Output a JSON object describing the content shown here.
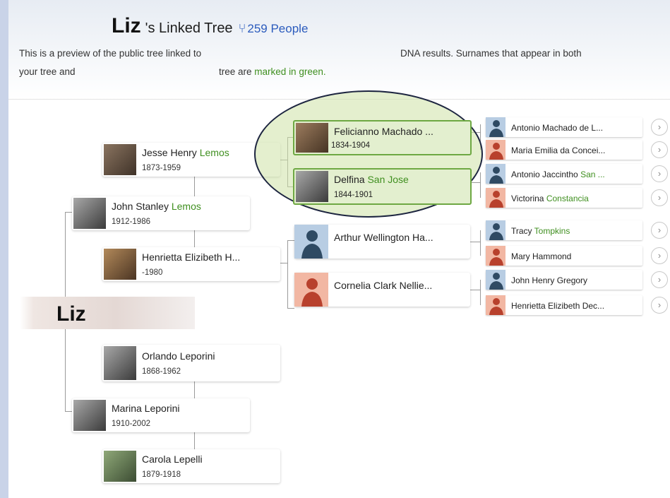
{
  "header": {
    "owner": "Liz",
    "title_suffix": "'s Linked Tree",
    "people_count": "259 People",
    "desc_line1_a": "This is a preview of the public tree linked to",
    "desc_line1_b": "DNA results. Surnames that appear in both",
    "desc_line2_a": "your tree and",
    "desc_line2_b": "tree are",
    "desc_line2_link": "marked in green."
  },
  "root": {
    "name": "Liz"
  },
  "people": {
    "jesse": {
      "first": "Jesse Henry ",
      "surname": "Lemos",
      "dates": "1873-1959"
    },
    "john_stanley": {
      "first": "John Stanley ",
      "surname": "Lemos",
      "dates": "1912-1986"
    },
    "henrietta_h": {
      "name": "Henrietta Elizibeth H...",
      "dates": "-1980"
    },
    "orlando": {
      "name": "Orlando Leporini",
      "dates": "1868-1962"
    },
    "marina": {
      "name": "Marina Leporini",
      "dates": "1910-2002"
    },
    "carola": {
      "name": "Carola Lepelli",
      "dates": "1879-1918"
    },
    "felicianno": {
      "name": "Felicianno Machado ...",
      "dates": "1834-1904"
    },
    "delfina": {
      "first": "Delfina ",
      "surname": "San Jose",
      "dates": "1844-1901"
    },
    "arthur": {
      "name": "Arthur Wellington Ha..."
    },
    "cornelia": {
      "name": "Cornelia Clark Nellie..."
    }
  },
  "ancestors": [
    {
      "name": "Antonio Machado de L...",
      "gender": "male"
    },
    {
      "name": "Maria Emilia da Concei...",
      "gender": "female"
    },
    {
      "first": "Antonio Jaccintho ",
      "surname": "San ...",
      "gender": "male"
    },
    {
      "first": "Victorina ",
      "surname": "Constancia",
      "gender": "female"
    },
    {
      "first": "Tracy ",
      "surname": "Tompkins",
      "gender": "male"
    },
    {
      "name": "Mary Hammond",
      "gender": "female"
    },
    {
      "name": "John Henry Gregory",
      "gender": "male"
    },
    {
      "name": "Henrietta Elizibeth Dec...",
      "gender": "female"
    }
  ],
  "icons": {
    "expand": "›",
    "tree": "family-tree-icon"
  },
  "colors": {
    "accent_blue": "#2b5bbd",
    "match_green": "#3f8f1f",
    "highlight_border": "#6ea843",
    "male_bg": "#b8cde3",
    "female_bg": "#f2b7a3"
  }
}
